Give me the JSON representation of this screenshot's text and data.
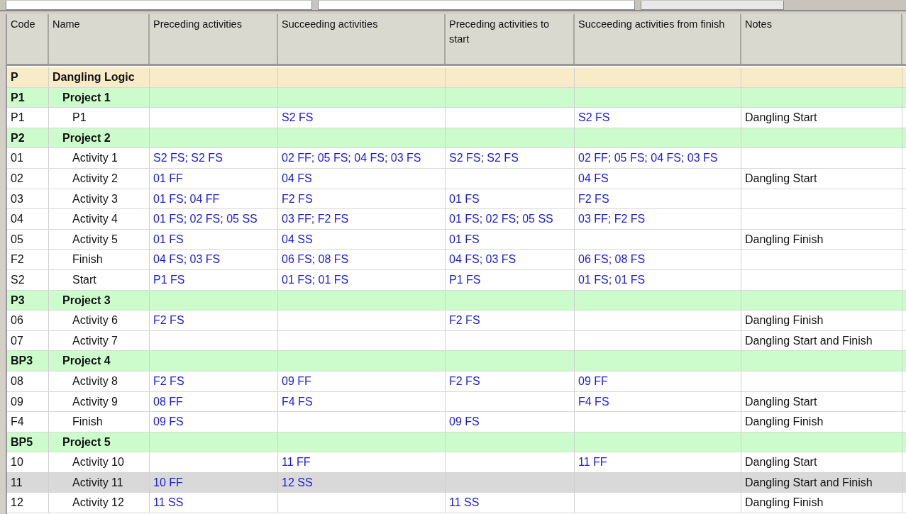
{
  "table": {
    "columns": [
      "Code",
      "Name",
      "Preceding activities",
      "Succeeding activities",
      "Preceding activities to start",
      "Succeeding activities from finish",
      "Notes"
    ],
    "rows": [
      {
        "kind": "root",
        "selected": false,
        "cells": [
          "P",
          "Dangling Logic",
          "",
          "",
          "",
          "",
          ""
        ]
      },
      {
        "kind": "project",
        "selected": false,
        "cells": [
          "P1",
          "Project 1",
          "",
          "",
          "",
          "",
          ""
        ]
      },
      {
        "kind": "activity",
        "selected": false,
        "cells": [
          "P1",
          "P1",
          "",
          "S2 FS",
          "",
          "S2 FS",
          "Dangling Start"
        ]
      },
      {
        "kind": "project",
        "selected": false,
        "cells": [
          "P2",
          "Project 2",
          "",
          "",
          "",
          "",
          ""
        ]
      },
      {
        "kind": "activity",
        "selected": false,
        "cells": [
          "01",
          "Activity 1",
          "S2 FS; S2 FS",
          "02 FF; 05 FS; 04 FS; 03 FS",
          "S2 FS; S2 FS",
          "02 FF; 05 FS; 04 FS; 03 FS",
          ""
        ]
      },
      {
        "kind": "activity",
        "selected": false,
        "cells": [
          "02",
          "Activity 2",
          "01 FF",
          "04 FS",
          "",
          "04 FS",
          "Dangling Start"
        ]
      },
      {
        "kind": "activity",
        "selected": false,
        "cells": [
          "03",
          "Activity 3",
          "01 FS; 04 FF",
          "F2 FS",
          "01 FS",
          "F2 FS",
          ""
        ]
      },
      {
        "kind": "activity",
        "selected": false,
        "cells": [
          "04",
          "Activity 4",
          "01 FS; 02 FS; 05 SS",
          "03 FF; F2 FS",
          "01 FS; 02 FS; 05 SS",
          "03 FF; F2 FS",
          ""
        ]
      },
      {
        "kind": "activity",
        "selected": false,
        "cells": [
          "05",
          "Activity 5",
          "01 FS",
          "04 SS",
          "01 FS",
          "",
          "Dangling Finish"
        ]
      },
      {
        "kind": "activity",
        "selected": false,
        "cells": [
          "F2",
          "Finish",
          "04 FS; 03 FS",
          "06 FS; 08 FS",
          "04 FS; 03 FS",
          "06 FS; 08 FS",
          ""
        ]
      },
      {
        "kind": "activity",
        "selected": false,
        "cells": [
          "S2",
          "Start",
          "P1 FS",
          "01 FS; 01 FS",
          "P1 FS",
          "01 FS; 01 FS",
          ""
        ]
      },
      {
        "kind": "project",
        "selected": false,
        "cells": [
          "P3",
          "Project 3",
          "",
          "",
          "",
          "",
          ""
        ]
      },
      {
        "kind": "activity",
        "selected": false,
        "cells": [
          "06",
          "Activity 6",
          "F2 FS",
          "",
          "F2 FS",
          "",
          "Dangling Finish"
        ]
      },
      {
        "kind": "activity",
        "selected": false,
        "cells": [
          "07",
          "Activity 7",
          "",
          "",
          "",
          "",
          "Dangling Start and Finish"
        ]
      },
      {
        "kind": "project",
        "selected": false,
        "cells": [
          "BP3",
          "Project 4",
          "",
          "",
          "",
          "",
          ""
        ]
      },
      {
        "kind": "activity",
        "selected": false,
        "cells": [
          "08",
          "Activity 8",
          "F2 FS",
          "09 FF",
          "F2 FS",
          "09 FF",
          ""
        ]
      },
      {
        "kind": "activity",
        "selected": false,
        "cells": [
          "09",
          "Activity 9",
          "08 FF",
          "F4 FS",
          "",
          "F4 FS",
          "Dangling Start"
        ]
      },
      {
        "kind": "activity",
        "selected": false,
        "cells": [
          "F4",
          "Finish",
          "09 FS",
          "",
          "09 FS",
          "",
          "Dangling Finish"
        ]
      },
      {
        "kind": "project",
        "selected": false,
        "cells": [
          "BP5",
          "Project 5",
          "",
          "",
          "",
          "",
          ""
        ]
      },
      {
        "kind": "activity",
        "selected": false,
        "cells": [
          "10",
          "Activity 10",
          "",
          "11 FF",
          "",
          "11 FF",
          "Dangling Start"
        ]
      },
      {
        "kind": "activity",
        "selected": true,
        "cells": [
          "11",
          "Activity 11",
          "10 FF",
          "12 SS",
          "",
          "",
          "Dangling Start and Finish"
        ]
      },
      {
        "kind": "activity",
        "selected": false,
        "cells": [
          "12",
          "Activity 12",
          "11 SS",
          "",
          "11 SS",
          "",
          "Dangling Finish"
        ]
      }
    ]
  }
}
